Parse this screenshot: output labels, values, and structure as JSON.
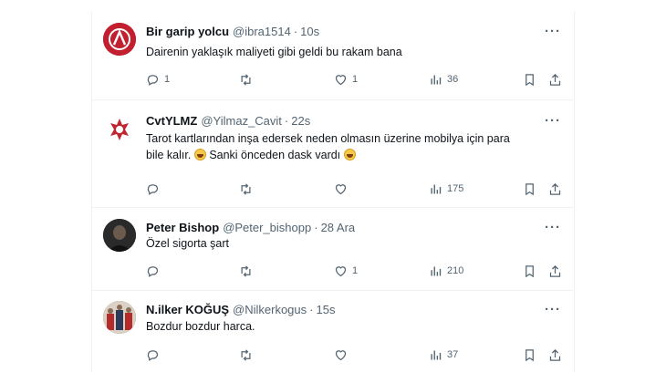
{
  "tweets": [
    {
      "name": "Bir garip yolcu",
      "handle": "@ibra1514",
      "time": "10s",
      "text_lines": [
        "Dairenin yaklaşık maliyeti gibi geldi bu rakam bana"
      ],
      "replies": "1",
      "retweets": "",
      "likes": "1",
      "views": "36",
      "avatar_color": "#b31b2a"
    },
    {
      "name": "CvtYLMZ",
      "handle": "@Yilmaz_Cavit",
      "time": "22s",
      "text_lines": [
        "Tarot kartlarından inşa edersek neden olmasın üzerine mobilya için para",
        "bile kalır.",
        "Sanki önceden dask vardı"
      ],
      "replies": "",
      "retweets": "",
      "likes": "",
      "views": "175",
      "avatar_color": "#ffffff"
    },
    {
      "name": "Peter Bishop",
      "handle": "@Peter_bishopp",
      "time": "28 Ara",
      "text_lines": [
        "Özel sigorta şart"
      ],
      "replies": "",
      "retweets": "",
      "likes": "1",
      "views": "210",
      "avatar_color": "#1c1c1c"
    },
    {
      "name": "N.ilker KOĞUŞ",
      "handle": "@Nilkerkogus",
      "time": "15s",
      "text_lines": [
        "Bozdur bozdur harca."
      ],
      "replies": "",
      "retweets": "",
      "likes": "",
      "views": "37",
      "avatar_color": "#8a2b2b"
    }
  ],
  "separator": "·",
  "more_label": "···",
  "colors": {
    "text": "#0f1419",
    "muted": "#536471",
    "border": "#eff3f4"
  }
}
